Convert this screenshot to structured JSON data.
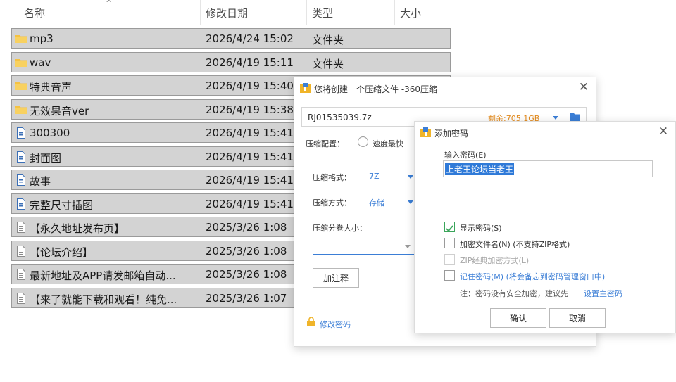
{
  "explorer": {
    "columns": {
      "name": "名称",
      "modified": "修改日期",
      "type": "类型",
      "size": "大小"
    },
    "sort_arrow": "^",
    "rows": [
      {
        "icon": "folder-icon",
        "name": "mp3",
        "date": "2026/4/24 15:02",
        "type": "文件夹"
      },
      {
        "icon": "folder-icon",
        "name": "wav",
        "date": "2026/4/19 15:11",
        "type": "文件夹"
      },
      {
        "icon": "folder-icon",
        "name": "特典音声",
        "date": "2026/4/19 15:40",
        "type": ""
      },
      {
        "icon": "folder-icon",
        "name": "无效果音ver",
        "date": "2026/4/19 15:38",
        "type": ""
      },
      {
        "icon": "file-icon",
        "name": "300300",
        "date": "2026/4/19 15:41",
        "type": ""
      },
      {
        "icon": "file-icon",
        "name": "封面图",
        "date": "2026/4/19 15:41",
        "type": ""
      },
      {
        "icon": "file-icon",
        "name": "故事",
        "date": "2026/4/19 15:41",
        "type": ""
      },
      {
        "icon": "file-icon",
        "name": "完整尺寸插图",
        "date": "2026/4/19 15:41",
        "type": ""
      },
      {
        "icon": "doc-icon",
        "name": "【永久地址发布页】",
        "date": "2025/3/26 1:08",
        "type": ""
      },
      {
        "icon": "doc-icon",
        "name": "【论坛介绍】",
        "date": "2025/3/26 1:08",
        "type": ""
      },
      {
        "icon": "doc-icon",
        "name": "最新地址及APP请发邮箱自动...",
        "date": "2025/3/26 1:08",
        "type": ""
      },
      {
        "icon": "doc-icon",
        "name": "【来了就能下载和观看！纯免...",
        "date": "2025/3/26 1:07",
        "type": ""
      }
    ]
  },
  "compress_dialog": {
    "title": "您将创建一个压缩文件 -360压缩",
    "filename": "RJ01535039.7z",
    "free_space": "剩余:705.1GB",
    "config_label": "压缩配置：",
    "speed_option": "速度最快",
    "format_label": "压缩格式：",
    "format_value": "7Z",
    "method_label": "压缩方式：",
    "method_value": "存储",
    "volume_label": "压缩分卷大小：",
    "volume_value": "",
    "comment_button": "加注释",
    "change_password": "修改密码"
  },
  "password_dialog": {
    "title": "添加密码",
    "input_label": "输入密码(E)",
    "password_value": "上老王论坛当老王",
    "show_password": "显示密码(S)",
    "encrypt_filename": "加密文件名(N) (不支持ZIP格式)",
    "zip_classic": "ZIP经典加密方式(L)",
    "remember_password": "记住密码(M) (将会备忘到密码管理窗口中)",
    "note_prefix": "注：密码没有安全加密，建议先",
    "note_link": "设置主密码",
    "ok_button": "确认",
    "cancel_button": "取消"
  },
  "colors": {
    "accent": "#3b7ed6",
    "orange": "#e38a1c",
    "row_bg": "#d3d3d3",
    "check_green": "#3aa55a"
  }
}
